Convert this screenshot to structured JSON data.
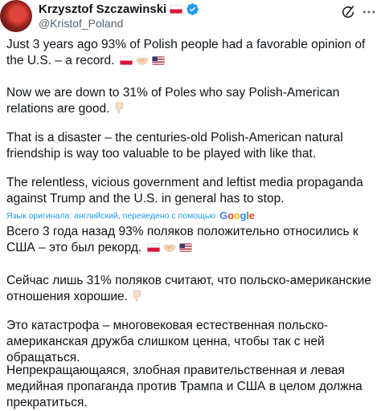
{
  "author": {
    "display_name": "Krzysztof Szczawinski",
    "handle": "@Kristof_Poland"
  },
  "icons": {
    "verified": "verified-badge-icon",
    "grok": "grok-icon",
    "more": "more-options-icon",
    "flag_pl": "poland-flag-icon",
    "flag_us": "usa-flag-icon",
    "handshake": "handshake-icon",
    "thumbs_down": "thumbs-down-icon"
  },
  "colors": {
    "text": "#0f1419",
    "secondary": "#536471",
    "link": "#1d9bf0",
    "verified": "#1d9bf0"
  },
  "original": {
    "p1": "Just 3 years ago 93% of Polish people had a favorable opinion of the U.S. – a record.",
    "p2": "Now we are down to 31% of Poles who say Polish-American relations are good.",
    "p3": "That is a disaster – the centuries-old Polish-American natural friendship is way too valuable to be played with like that.",
    "p4": "The relentless, vicious government and leftist media propaganda against Trump and the U.S. in general has to stop."
  },
  "translation": {
    "notice": "Язык оригинала: английский, переведено с помощью",
    "provider": "Google",
    "p1": "Всего 3 года назад 93% поляков положительно относились к США – это был рекорд.",
    "p2": "Сейчас лишь 31% поляков считают, что польско-американские отношения хорошие.",
    "p3": "Это катастрофа – многовековая естественная польско-американская дружба слишком ценна, чтобы так с ней обращаться.",
    "p4": "Непрекращающаяся, злобная правительственная и левая медийная пропаганда против Трампа и США в целом должна прекратиться."
  }
}
